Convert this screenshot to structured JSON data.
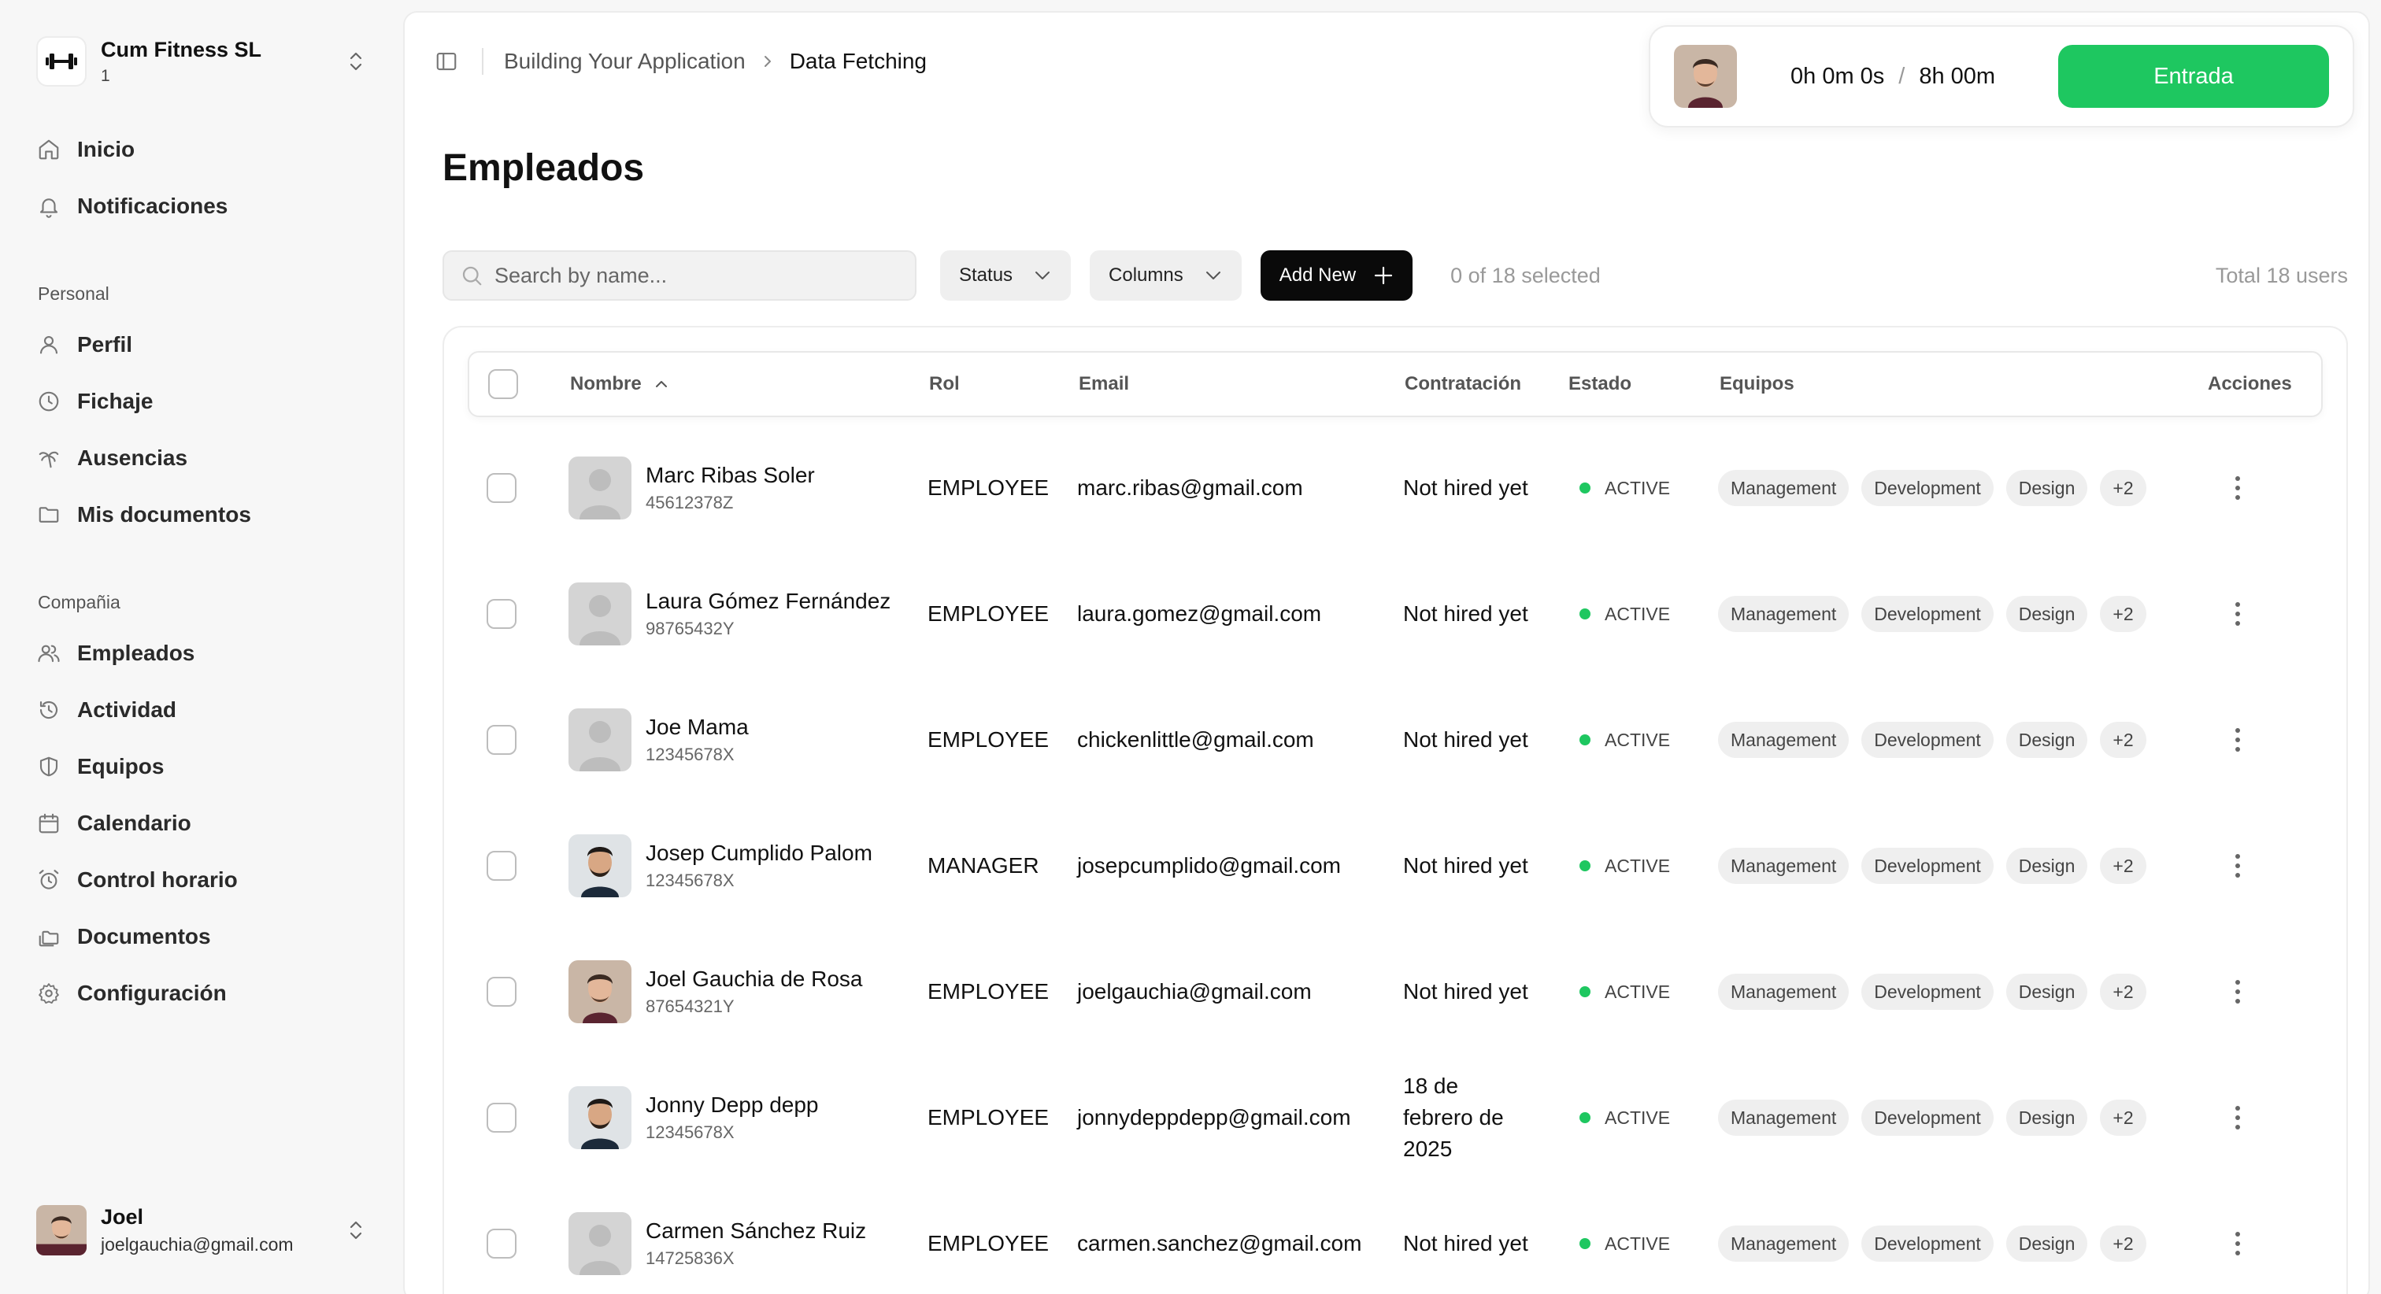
{
  "company": {
    "name": "Cum Fitness SL",
    "sub": "1"
  },
  "nav": {
    "top": [
      {
        "label": "Inicio",
        "icon": "home-icon"
      },
      {
        "label": "Notificaciones",
        "icon": "bell-icon"
      }
    ],
    "personal_title": "Personal",
    "personal": [
      {
        "label": "Perfil",
        "icon": "user-icon"
      },
      {
        "label": "Fichaje",
        "icon": "clock-icon"
      },
      {
        "label": "Ausencias",
        "icon": "palm-tree-icon"
      },
      {
        "label": "Mis documentos",
        "icon": "folder-icon"
      }
    ],
    "company_title": "Compañia",
    "company": [
      {
        "label": "Empleados",
        "icon": "users-icon"
      },
      {
        "label": "Actividad",
        "icon": "history-icon"
      },
      {
        "label": "Equipos",
        "icon": "shield-icon"
      },
      {
        "label": "Calendario",
        "icon": "calendar-icon"
      },
      {
        "label": "Control horario",
        "icon": "alarm-clock-icon"
      },
      {
        "label": "Documentos",
        "icon": "folders-icon"
      },
      {
        "label": "Configuración",
        "icon": "gear-icon"
      }
    ]
  },
  "user": {
    "name": "Joel",
    "email": "joelgauchia@gmail.com"
  },
  "breadcrumb": {
    "parent": "Building Your Application",
    "current": "Data Fetching"
  },
  "clock": {
    "worked": "0h 0m 0s",
    "separator": "/",
    "target": "8h 00m",
    "button": "Entrada"
  },
  "page": {
    "title": "Empleados"
  },
  "toolbar": {
    "search_placeholder": "Search by name...",
    "status_label": "Status",
    "columns_label": "Columns",
    "add_label": "Add New",
    "selected": "0 of 18 selected",
    "total": "Total 18 users"
  },
  "table": {
    "headers": {
      "name": "Nombre",
      "role": "Rol",
      "email": "Email",
      "hire": "Contratación",
      "status": "Estado",
      "teams": "Equipos",
      "actions": "Acciones"
    },
    "rows": [
      {
        "name": "Marc Ribas Soler",
        "dni": "45612378Z",
        "role": "EMPLOYEE",
        "email": "marc.ribas@gmail.com",
        "hire": "Not hired yet",
        "status": "ACTIVE",
        "avatar": "placeholder",
        "teams": [
          "Management",
          "Development",
          "Design",
          "+2"
        ]
      },
      {
        "name": "Laura Gómez Fernández",
        "dni": "98765432Y",
        "role": "EMPLOYEE",
        "email": "laura.gomez@gmail.com",
        "hire": "Not hired yet",
        "status": "ACTIVE",
        "avatar": "placeholder",
        "teams": [
          "Management",
          "Development",
          "Design",
          "+2"
        ]
      },
      {
        "name": "Joe Mama",
        "dni": "12345678X",
        "role": "EMPLOYEE",
        "email": "chickenlittle@gmail.com",
        "hire": "Not hired yet",
        "status": "ACTIVE",
        "avatar": "placeholder",
        "teams": [
          "Management",
          "Development",
          "Design",
          "+2"
        ]
      },
      {
        "name": "Josep Cumplido Palom",
        "dni": "12345678X",
        "role": "MANAGER",
        "email": "josepcumplido@gmail.com",
        "hire": "Not hired yet",
        "status": "ACTIVE",
        "avatar": "photo-a",
        "teams": [
          "Management",
          "Development",
          "Design",
          "+2"
        ]
      },
      {
        "name": "Joel Gauchia de Rosa",
        "dni": "87654321Y",
        "role": "EMPLOYEE",
        "email": "joelgauchia@gmail.com",
        "hire": "Not hired yet",
        "status": "ACTIVE",
        "avatar": "photo-b",
        "teams": [
          "Management",
          "Development",
          "Design",
          "+2"
        ]
      },
      {
        "name": "Jonny Depp depp",
        "dni": "12345678X",
        "role": "EMPLOYEE",
        "email": "jonnydeppdepp@gmail.com",
        "hire": "18 de febrero de 2025",
        "status": "ACTIVE",
        "avatar": "photo-a",
        "teams": [
          "Management",
          "Development",
          "Design",
          "+2"
        ]
      },
      {
        "name": "Carmen Sánchez Ruiz",
        "dni": "14725836X",
        "role": "EMPLOYEE",
        "email": "carmen.sanchez@gmail.com",
        "hire": "Not hired yet",
        "status": "ACTIVE",
        "avatar": "placeholder",
        "teams": [
          "Management",
          "Development",
          "Design",
          "+2"
        ]
      }
    ]
  },
  "colors": {
    "accent": "#1ec760",
    "dark": "#0a0a0a",
    "muted": "#999999"
  }
}
